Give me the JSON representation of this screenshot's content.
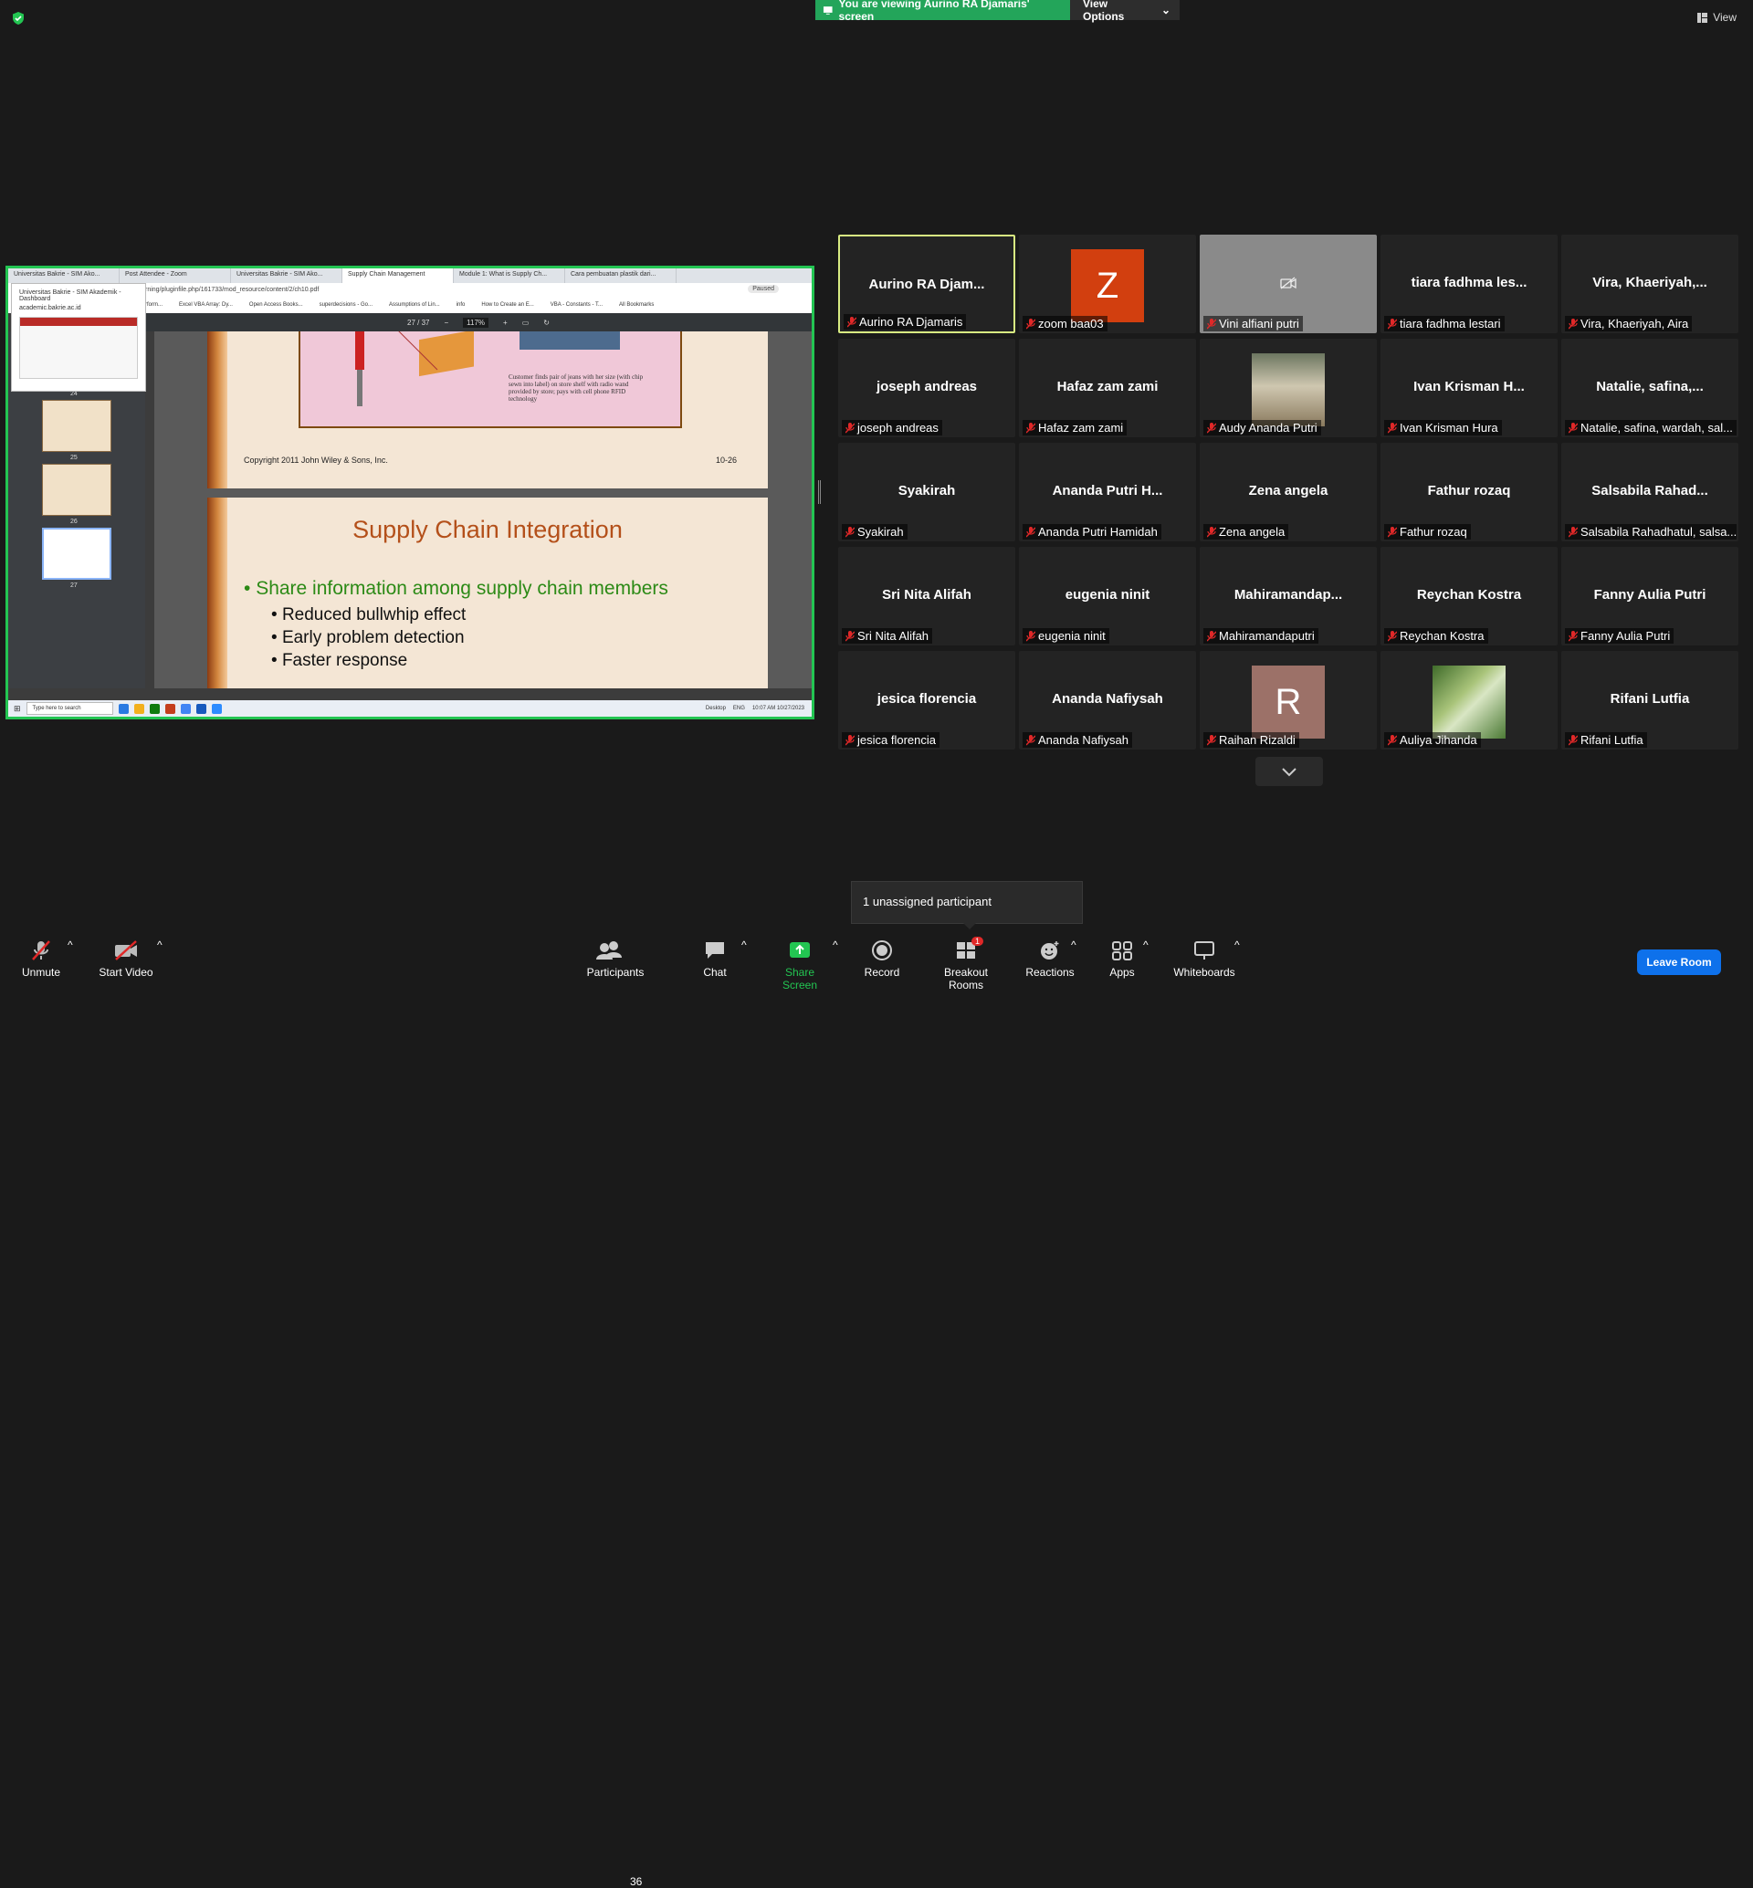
{
  "banner": {
    "viewing_text": "You are viewing Aurino RA Djamaris' screen",
    "view_options": "View Options"
  },
  "top_right": {
    "view_label": "View"
  },
  "shared_screen": {
    "tabs": [
      "Universitas Bakrie - SIM Ako...",
      "Post Attendee - Zoom",
      "Universitas Bakrie - SIM Ako...",
      "Supply Chain Management",
      "Module 1: What is Supply Ch...",
      "Cara pembuatan plastik dari..."
    ],
    "tooltip": {
      "title": "Universitas Bakrie - SIM Akademik - Dashboard",
      "url": "academic.bakrie.ac.id"
    },
    "address": "rning/pluginfile.php/161733/mod_resource/content/2/ch10.pdf",
    "bookmarks": [
      "rform...",
      "Excel VBA Array: Dy...",
      "Open Access Books...",
      "superdecisions - Go...",
      "Assumptions of Lin...",
      "info",
      "How to Create an E...",
      "VBA - Constants - T...",
      "All Bookmarks"
    ],
    "pdf_page": "27",
    "pdf_total": "/ 37",
    "pdf_zoom": "117%",
    "thumb_numbers": [
      "24",
      "25",
      "26",
      "27"
    ],
    "slide_top": {
      "caption": "Customer finds pair of jeans with her size (with chip sewn into label) on store shelf with radio wand provided by store; pays with cell phone RFID technology",
      "copyright": "Copyright 2011 John Wiley & Sons, Inc.",
      "page_number": "10-26"
    },
    "slide_bottom": {
      "title": "Supply Chain Integration",
      "bullet": "Share information among supply chain members",
      "sub_bullets": [
        "Reduced bullwhip effect",
        "Early problem detection",
        "Faster response"
      ]
    },
    "taskbar": {
      "search": "Type here to search",
      "desktop": "Desktop",
      "lang": "ENG",
      "time": "10:07 AM",
      "date": "10/27/2023",
      "paused": "Paused"
    }
  },
  "participants": [
    {
      "center": "Aurino RA Djam...",
      "label": "Aurino RA Djamaris",
      "active": true
    },
    {
      "avatar": "Z",
      "avatar_color": "#d23f0f",
      "label": "zoom baa03"
    },
    {
      "video_off": true,
      "label": "Vini alfiani putri"
    },
    {
      "center": "tiara fadhma les...",
      "label": "tiara fadhma lestari"
    },
    {
      "center": "Vira, Khaeriyah,...",
      "label": "Vira, Khaeriyah, Aira"
    },
    {
      "center": "joseph andreas",
      "label": "joseph andreas"
    },
    {
      "center": "Hafaz zam zami",
      "label": "Hafaz zam zami"
    },
    {
      "photo": "photo-woman",
      "label": "Audy Ananda Putri"
    },
    {
      "center": "Ivan Krisman H...",
      "label": "Ivan Krisman Hura"
    },
    {
      "center": "Natalie, safina,...",
      "label": "Natalie, safina, wardah, sal..."
    },
    {
      "center": "Syakirah",
      "label": "Syakirah"
    },
    {
      "center": "Ananda Putri H...",
      "label": "Ananda Putri Hamidah"
    },
    {
      "center": "Zena angela",
      "label": "Zena angela"
    },
    {
      "center": "Fathur rozaq",
      "label": "Fathur rozaq"
    },
    {
      "center": "Salsabila Rahad...",
      "label": "Salsabila Rahadhatul, salsa..."
    },
    {
      "center": "Sri Nita Alifah",
      "label": "Sri Nita Alifah"
    },
    {
      "center": "eugenia ninit",
      "label": "eugenia ninit"
    },
    {
      "center": "Mahiramandap...",
      "label": "Mahiramandaputri"
    },
    {
      "center": "Reychan Kostra",
      "label": "Reychan Kostra"
    },
    {
      "center": "Fanny Aulia Putri",
      "label": "Fanny Aulia Putri"
    },
    {
      "center": "jesica florencia",
      "label": "jesica florencia"
    },
    {
      "center": "Ananda Nafiysah",
      "label": "Ananda Nafiysah"
    },
    {
      "avatar": "R",
      "avatar_color": "#9c7168",
      "label": "Raihan Rizaldi"
    },
    {
      "photo": "photo-nature",
      "label": "Auliya Jihanda"
    },
    {
      "center": "Rifani Lutfia",
      "label": "Rifani Lutfia"
    }
  ],
  "unassigned": "1 unassigned participant",
  "toolbar": {
    "unmute": "Unmute",
    "start_video": "Start Video",
    "participants": "Participants",
    "participants_count": "36",
    "chat": "Chat",
    "share_screen": "Share Screen",
    "record": "Record",
    "breakout_rooms": "Breakout Rooms",
    "breakout_badge": "1",
    "reactions": "Reactions",
    "apps": "Apps",
    "whiteboards": "Whiteboards",
    "leave_room": "Leave Room"
  },
  "colors": {
    "share_green": "#23a55a",
    "leave_blue": "#0e71eb",
    "active_border": "#d8ec82"
  }
}
